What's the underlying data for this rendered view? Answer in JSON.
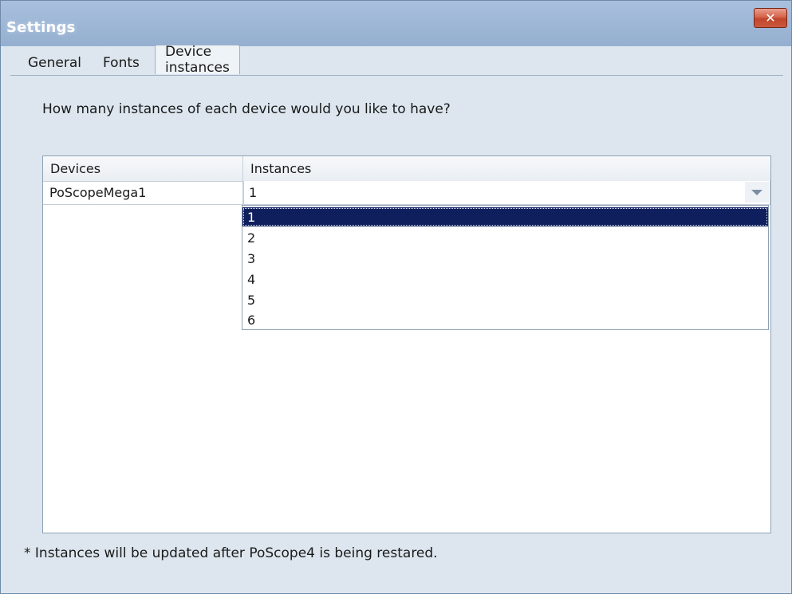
{
  "window": {
    "title": "Settings",
    "close_label": "✕"
  },
  "tabs": [
    {
      "label": "General",
      "active": false
    },
    {
      "label": "Fonts",
      "active": false
    },
    {
      "label": "Device instances",
      "active": true
    }
  ],
  "panel": {
    "question": "How many instances of each device would you like to have?",
    "table": {
      "columns": [
        "Devices",
        "Instances"
      ],
      "rows": [
        {
          "device": "PoScopeMega1",
          "instances": "1"
        }
      ]
    },
    "dropdown": {
      "options": [
        "1",
        "2",
        "3",
        "4",
        "5",
        "6"
      ],
      "selected": "1"
    },
    "note": "* Instances will be updated after PoScope4 is being restared."
  },
  "colors": {
    "title_bar": "#9fb8d7",
    "window_background": "#dde6ee",
    "selection": "#0f1f5e",
    "close_button": "#c95a40"
  },
  "icons": {
    "close": "close-icon",
    "dropdown": "chevron-down-icon"
  }
}
